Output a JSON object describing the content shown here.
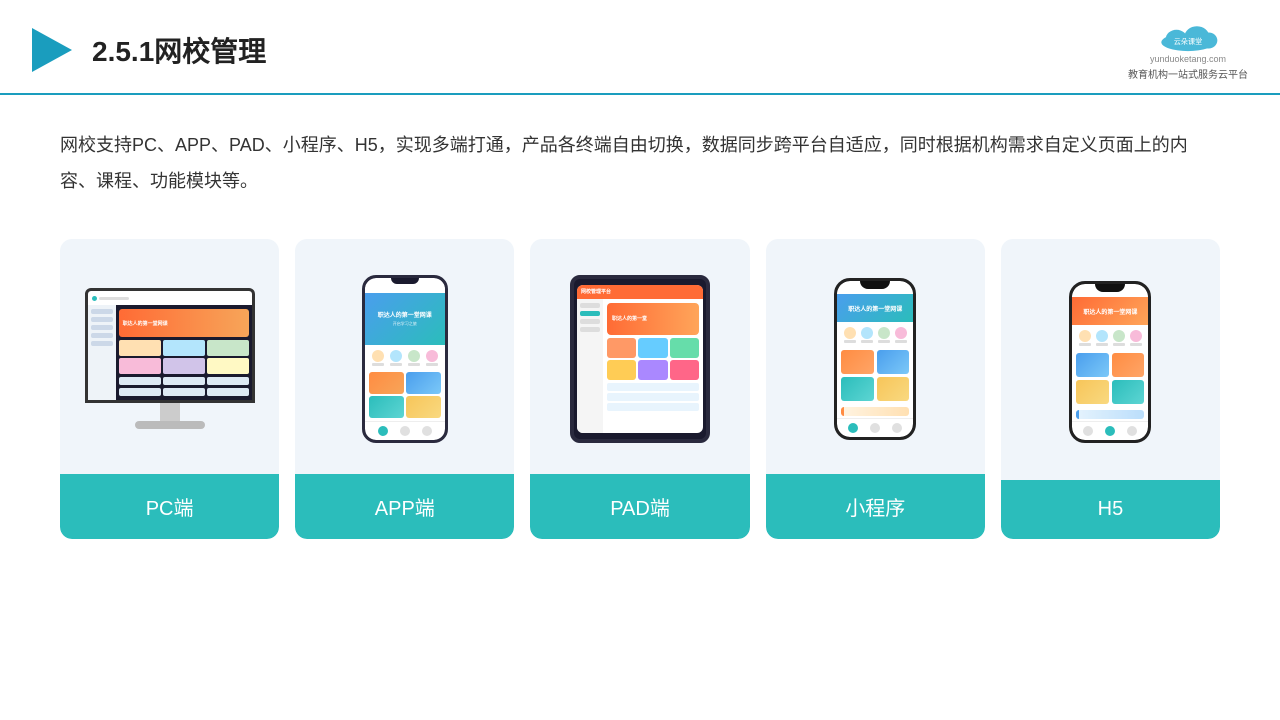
{
  "header": {
    "title": "2.5.1网校管理",
    "logo_name": "云朵课堂",
    "logo_url": "yunduoketang.com",
    "logo_tagline": "教育机构一站式服务云平台"
  },
  "description": {
    "text": "网校支持PC、APP、PAD、小程序、H5，实现多端打通，产品各终端自由切换，数据同步跨平台自适应，同时根据机构需求自定义页面上的内容、课程、功能模块等。"
  },
  "cards": [
    {
      "label": "PC端",
      "type": "pc"
    },
    {
      "label": "APP端",
      "type": "app"
    },
    {
      "label": "PAD端",
      "type": "pad"
    },
    {
      "label": "小程序",
      "type": "miniapp"
    },
    {
      "label": "H5",
      "type": "h5"
    }
  ]
}
